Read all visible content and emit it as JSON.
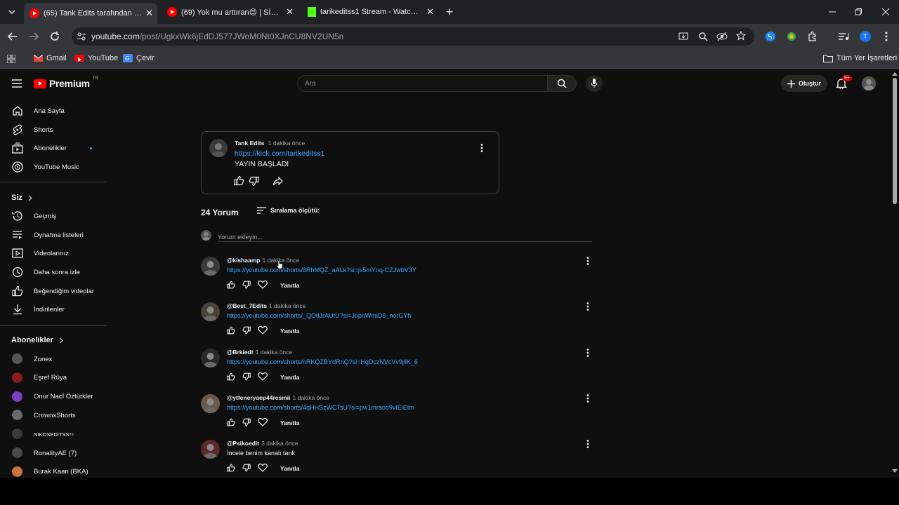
{
  "browser": {
    "tabs": [
      {
        "label": "(65) Tank Edits tarafından payla",
        "active": true,
        "favicon": "youtube-favicon"
      },
      {
        "label": "(69) Yok mu arttıran😍 | SİNEM",
        "active": false,
        "favicon": "youtube-favicon"
      },
      {
        "label": "tarikeditss1 Stream - Watch Live",
        "active": false,
        "favicon": "kick-favicon"
      }
    ],
    "new_tab": "+",
    "url_domain": "youtube.com",
    "url_path": "/post/UgkxWk6jEdDJ577JWoM0Nt0XJnCU8NV2UN5n",
    "profile_initial": "T",
    "bookmarks": [
      {
        "label": "Gmail"
      },
      {
        "label": "YouTube"
      },
      {
        "label": "Çevir"
      }
    ],
    "all_bookmarks": "Tüm Yer İşaretleri"
  },
  "youtube": {
    "logo_text": "Premium",
    "logo_country": "TR",
    "search_placeholder": "Ara",
    "create_label": "Oluştur",
    "notification_count": "9+",
    "sidebar": {
      "main": [
        {
          "label": "Ana Sayfa",
          "icon": "home-icon"
        },
        {
          "label": "Shorts",
          "icon": "shorts-icon"
        },
        {
          "label": "Abonelikler",
          "icon": "subscriptions-icon"
        },
        {
          "label": "YouTube Music",
          "icon": "music-icon"
        }
      ],
      "you_header": "Siz",
      "you": [
        {
          "label": "Geçmiş",
          "icon": "history-icon"
        },
        {
          "label": "Oynatma listeleri",
          "icon": "playlist-icon"
        },
        {
          "label": "Videolarınız",
          "icon": "your-videos-icon"
        },
        {
          "label": "Daha sonra izle",
          "icon": "watch-later-icon"
        },
        {
          "label": "Beğendiğim videolar",
          "icon": "liked-icon"
        },
        {
          "label": "İndirilenler",
          "icon": "download-icon"
        }
      ],
      "subs_header": "Abonelikler",
      "subscriptions": [
        {
          "label": "Zonex",
          "color": "#555555"
        },
        {
          "label": "Eşref Rüya",
          "color": "#8a1c1c"
        },
        {
          "label": "Onur Nacİ Öztürkler",
          "color": "#7a3fc0"
        },
        {
          "label": "CrownxShorts",
          "color": "#6a6a6a"
        },
        {
          "label": "NIKOSEDITSS⁸⁹",
          "color": "#3a3a3a"
        },
        {
          "label": "RonalityAE (7)",
          "color": "#4a4a4a"
        },
        {
          "label": "Burak Kaan (BKA)",
          "color": "#c8733a"
        }
      ]
    },
    "post": {
      "author": "Tank Edits",
      "time": "1 dakika önce",
      "link": "https://kick.com/tarikeditss1",
      "text": "YAYIN BAŞLADI"
    },
    "comments_header": {
      "count": "24 Yorum",
      "sort_label": "Sıralama ölçütü:"
    },
    "add_comment_placeholder": "Yorum ekleyin...",
    "reply_label": "Yanıtla",
    "comments": [
      {
        "author": "@kishaamp",
        "time": "1 dakika önce",
        "text": "https://youtube.com/shorts/8RhMQZ_aALk?si=js5mYnq-CZJwbV3Y",
        "is_link": true,
        "avatar_color": "#3a3a3a"
      },
      {
        "author": "@Best_7Edits",
        "time": "1 dakika önce",
        "text": "https://youtube.com/shorts/_QOtlJrAUtU?si=JopnWmlD8_norGYh",
        "is_link": true,
        "avatar_color": "#4a4235"
      },
      {
        "author": "@Brkiedt",
        "time": "1 dakika önce",
        "text": "https://youtube.com/shorts/nRKQZBYdRnQ?si=HgDczNVcVv9jllK_6",
        "is_link": true,
        "avatar_color": "#2a2a2a"
      },
      {
        "author": "@ytfeneryaep44resmii",
        "time": "1 dakika önce",
        "text": "https://youtube.com/shorts/4qHHSzWCTsU?si=pw1mraoo9vIEiEtm",
        "is_link": true,
        "avatar_color": "#6b5a4a"
      },
      {
        "author": "@Psikoedit",
        "time": "3 dakika önce",
        "text": "İncele benim kanalı tank",
        "is_link": false,
        "avatar_color": "#5a2a2a"
      }
    ]
  }
}
